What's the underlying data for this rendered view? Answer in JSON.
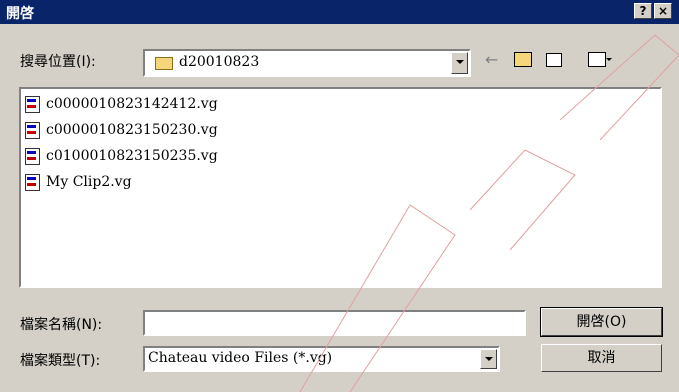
{
  "window": {
    "title": "開啓"
  },
  "look_in": {
    "label": "搜尋位置(I):",
    "value": "d20010823"
  },
  "files": [
    "c0000010823142412.vg",
    "c0000010823150230.vg",
    "c0100010823150235.vg",
    "My Clip2.vg"
  ],
  "filename": {
    "label": "檔案名稱(N):",
    "value": ""
  },
  "filetype": {
    "label": "檔案類型(T):",
    "value": "Chateau video Files (*.vg)"
  },
  "buttons": {
    "open": "開啓(O)",
    "cancel": "取消"
  },
  "icons": {
    "help": "?",
    "close": "×"
  }
}
